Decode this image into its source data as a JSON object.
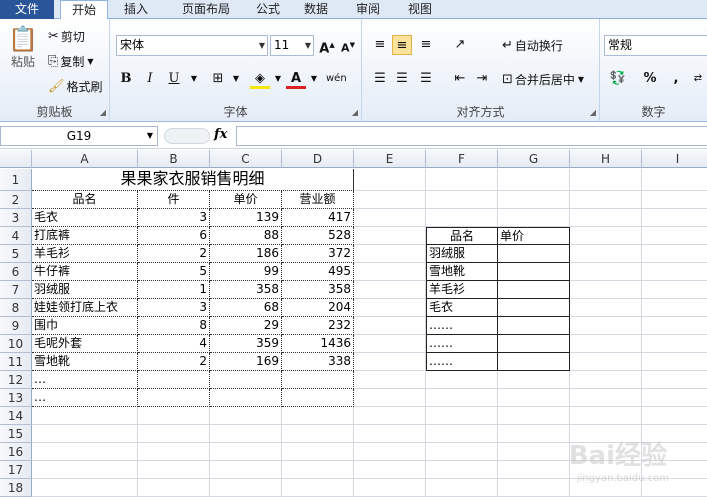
{
  "tabs": [
    "文件",
    "开始",
    "插入",
    "页面布局",
    "公式",
    "数据",
    "审阅",
    "视图"
  ],
  "ribbon": {
    "clipboard": {
      "paste": "粘贴",
      "cut": "剪切",
      "copy": "复制",
      "format_painter": "格式刷",
      "label": "剪贴板"
    },
    "font": {
      "name": "宋体",
      "size": "11",
      "bold": "B",
      "italic": "I",
      "underline": "U",
      "label": "字体",
      "grow": "A",
      "shrink": "A",
      "wen": "wén"
    },
    "align": {
      "wrap": "自动换行",
      "merge": "合并后居中",
      "label": "对齐方式"
    },
    "number": {
      "format": "常规",
      "percent": "%",
      "comma": ",",
      "label": "数字"
    }
  },
  "formula_bar": {
    "name_box": "G19",
    "fx": "fx",
    "value": ""
  },
  "columns": [
    "A",
    "B",
    "C",
    "D",
    "E",
    "F",
    "G",
    "H",
    "I"
  ],
  "rows": [
    "1",
    "2",
    "3",
    "4",
    "5",
    "6",
    "7",
    "8",
    "9",
    "10",
    "11",
    "12",
    "13",
    "14",
    "15",
    "16",
    "17",
    "18"
  ],
  "sheet": {
    "title": "果果家衣服销售明细",
    "headers": [
      "品名",
      "件",
      "单价",
      "营业额"
    ],
    "data": [
      [
        "毛衣",
        "3",
        "139",
        "417"
      ],
      [
        "打底裤",
        "6",
        "88",
        "528"
      ],
      [
        "羊毛衫",
        "2",
        "186",
        "372"
      ],
      [
        "牛仔裤",
        "5",
        "99",
        "495"
      ],
      [
        "羽绒服",
        "1",
        "358",
        "358"
      ],
      [
        "娃娃领打底上衣",
        "3",
        "68",
        "204"
      ],
      [
        "围巾",
        "8",
        "29",
        "232"
      ],
      [
        "毛呢外套",
        "4",
        "359",
        "1436"
      ],
      [
        "雪地靴",
        "2",
        "169",
        "338"
      ],
      [
        "…",
        "",
        "",
        ""
      ],
      [
        "…",
        "",
        "",
        ""
      ]
    ],
    "lookup_headers": [
      "品名",
      "单价"
    ],
    "lookup": [
      "羽绒服",
      "雪地靴",
      "羊毛衫",
      "毛衣",
      "……",
      "……",
      "……"
    ]
  },
  "watermark": {
    "logo": "Bai经验",
    "url": "jingyan.baidu.com"
  }
}
